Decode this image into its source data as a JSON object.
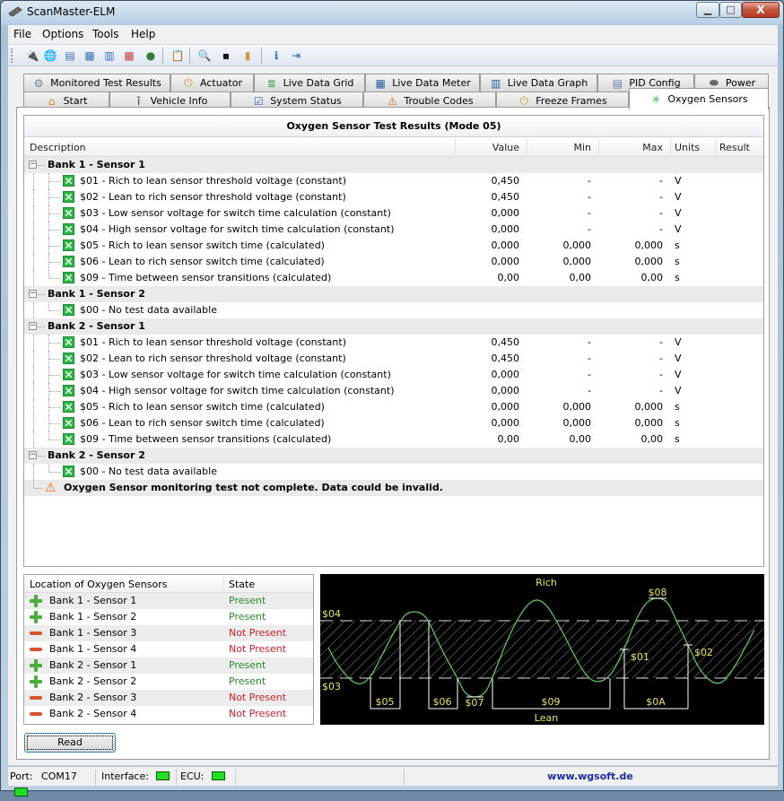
{
  "window": {
    "title": "ScanMaster-ELM",
    "min_label": "—",
    "max_label": "□",
    "close_label": "X"
  },
  "menu": [
    "File",
    "Options",
    "Tools",
    "Help"
  ],
  "toolbar": [
    {
      "icon": "connect-cable-icon",
      "glyph": "🔌"
    },
    {
      "icon": "globe-icon",
      "glyph": "🌐"
    },
    {
      "icon": "pid-config-icon",
      "glyph": "▤"
    },
    {
      "icon": "live-data-grid-icon",
      "glyph": "▦"
    },
    {
      "icon": "live-data-graph-icon",
      "glyph": "▥"
    },
    {
      "icon": "color-chart-icon",
      "glyph": "▩"
    },
    {
      "icon": "user-icon",
      "glyph": "●"
    },
    {
      "icon": "clipboard-icon",
      "glyph": "📋"
    },
    {
      "icon": "monitor-search-icon",
      "glyph": "🔍"
    },
    {
      "icon": "terminal-icon",
      "glyph": "▪"
    },
    {
      "icon": "battery-icon",
      "glyph": "▮"
    },
    {
      "icon": "info-icon",
      "glyph": "ℹ"
    },
    {
      "icon": "exit-door-icon",
      "glyph": "⇥"
    }
  ],
  "tabs_top": [
    {
      "label": "Monitored Test Results",
      "icon": "gear-icon",
      "glyph": "⚙"
    },
    {
      "label": "Actuator",
      "icon": "joystick-icon",
      "glyph": "⏻"
    },
    {
      "label": "Live Data Grid",
      "icon": "list-icon",
      "glyph": "≣"
    },
    {
      "label": "Live Data Meter",
      "icon": "grid-icon",
      "glyph": "▦"
    },
    {
      "label": "Live Data Graph",
      "icon": "bar-graph-icon",
      "glyph": "▥"
    },
    {
      "label": "PID Config",
      "icon": "document-icon",
      "glyph": "▤"
    },
    {
      "label": "Power",
      "icon": "chip-icon",
      "glyph": "⬬"
    }
  ],
  "tabs_bottom": [
    {
      "label": "Start",
      "icon": "home-icon",
      "glyph": "⌂"
    },
    {
      "label": "Vehicle Info",
      "icon": "info-i-icon",
      "glyph": "ĩ"
    },
    {
      "label": "System Status",
      "icon": "checkbox-icon",
      "glyph": "☑"
    },
    {
      "label": "Trouble Codes",
      "icon": "warning-icon",
      "glyph": "⚠"
    },
    {
      "label": "Freeze Frames",
      "icon": "joystick-icon",
      "glyph": "⏻"
    },
    {
      "label": "Oxygen Sensors",
      "icon": "oxygen-sensor-icon",
      "glyph": "✳",
      "active": true
    }
  ],
  "results": {
    "title": "Oxygen Sensor Test Results (Mode 05)",
    "columns": [
      "Description",
      "Value",
      "Min",
      "Max",
      "Units",
      "Result"
    ],
    "groups": [
      {
        "name": "Bank 1 - Sensor 1",
        "items": [
          {
            "desc": "$01 - Rich to lean sensor threshold voltage (constant)",
            "value": "0,450",
            "min": "-",
            "max": "-",
            "units": "V",
            "result": ""
          },
          {
            "desc": "$02 - Lean to rich sensor threshold voltage (constant)",
            "value": "0,450",
            "min": "-",
            "max": "-",
            "units": "V",
            "result": ""
          },
          {
            "desc": "$03 - Low sensor voltage for switch time calculation (constant)",
            "value": "0,000",
            "min": "-",
            "max": "-",
            "units": "V",
            "result": ""
          },
          {
            "desc": "$04 - High sensor voltage for switch time calculation (constant)",
            "value": "0,000",
            "min": "-",
            "max": "-",
            "units": "V",
            "result": ""
          },
          {
            "desc": "$05 - Rich to lean sensor switch time (calculated)",
            "value": "0,000",
            "min": "0,000",
            "max": "0,000",
            "units": "s",
            "result": ""
          },
          {
            "desc": "$06 - Lean to rich sensor switch time (calculated)",
            "value": "0,000",
            "min": "0,000",
            "max": "0,000",
            "units": "s",
            "result": ""
          },
          {
            "desc": "$09 - Time between sensor transitions (calculated)",
            "value": "0,00",
            "min": "0,00",
            "max": "0,00",
            "units": "s",
            "result": ""
          }
        ]
      },
      {
        "name": "Bank 1 - Sensor 2",
        "items": [
          {
            "desc": "$00 - No test data available",
            "value": "",
            "min": "",
            "max": "",
            "units": "",
            "result": ""
          }
        ]
      },
      {
        "name": "Bank 2 - Sensor 1",
        "items": [
          {
            "desc": "$01 - Rich to lean sensor threshold voltage (constant)",
            "value": "0,450",
            "min": "-",
            "max": "-",
            "units": "V",
            "result": ""
          },
          {
            "desc": "$02 - Lean to rich sensor threshold voltage (constant)",
            "value": "0,450",
            "min": "-",
            "max": "-",
            "units": "V",
            "result": ""
          },
          {
            "desc": "$03 - Low sensor voltage for switch time calculation (constant)",
            "value": "0,000",
            "min": "-",
            "max": "-",
            "units": "V",
            "result": ""
          },
          {
            "desc": "$04 - High sensor voltage for switch time calculation (constant)",
            "value": "0,000",
            "min": "-",
            "max": "-",
            "units": "V",
            "result": ""
          },
          {
            "desc": "$05 - Rich to lean sensor switch time (calculated)",
            "value": "0,000",
            "min": "0,000",
            "max": "0,000",
            "units": "s",
            "result": ""
          },
          {
            "desc": "$06 - Lean to rich sensor switch time (calculated)",
            "value": "0,000",
            "min": "0,000",
            "max": "0,000",
            "units": "s",
            "result": ""
          },
          {
            "desc": "$09 - Time between sensor transitions (calculated)",
            "value": "0,00",
            "min": "0,00",
            "max": "0,00",
            "units": "s",
            "result": ""
          }
        ]
      },
      {
        "name": "Bank 2 - Sensor 2",
        "items": [
          {
            "desc": "$00 - No test data available",
            "value": "",
            "min": "",
            "max": "",
            "units": "",
            "result": ""
          }
        ]
      }
    ],
    "warning": "Oxygen Sensor monitoring test not complete. Data could be invalid."
  },
  "locations": {
    "columns": [
      "Location of Oxygen Sensors",
      "State"
    ],
    "rows": [
      {
        "name": "Bank 1 - Sensor 1",
        "state": "Present",
        "present": true
      },
      {
        "name": "Bank 1 - Sensor 2",
        "state": "Present",
        "present": true
      },
      {
        "name": "Bank 1 - Sensor 3",
        "state": "Not Present",
        "present": false
      },
      {
        "name": "Bank 1 - Sensor 4",
        "state": "Not Present",
        "present": false
      },
      {
        "name": "Bank 2 - Sensor 1",
        "state": "Present",
        "present": true
      },
      {
        "name": "Bank 2 - Sensor 2",
        "state": "Present",
        "present": true
      },
      {
        "name": "Bank 2 - Sensor 3",
        "state": "Not Present",
        "present": false
      },
      {
        "name": "Bank 2 - Sensor 4",
        "state": "Not Present",
        "present": false
      }
    ]
  },
  "diagram": {
    "top_label": "Rich",
    "bottom_label": "Lean",
    "labels": {
      "high": "$04",
      "low": "$03",
      "rl_time": "$05",
      "lr_time": "$06",
      "min_v": "$07",
      "max_v": "$08",
      "trans_time": "$09",
      "period": "$0A",
      "rl_thresh": "$01",
      "lr_thresh": "$02"
    },
    "colors": {
      "wave": "#5fd35f",
      "label": "#e8e85a",
      "line": "#ffffff"
    }
  },
  "read_button": "Read",
  "statusbar": {
    "port_label": "Port:",
    "port_value": "COM17",
    "interface_label": "Interface:",
    "ecu_label": "ECU:",
    "link": "www.wgsoft.de"
  }
}
